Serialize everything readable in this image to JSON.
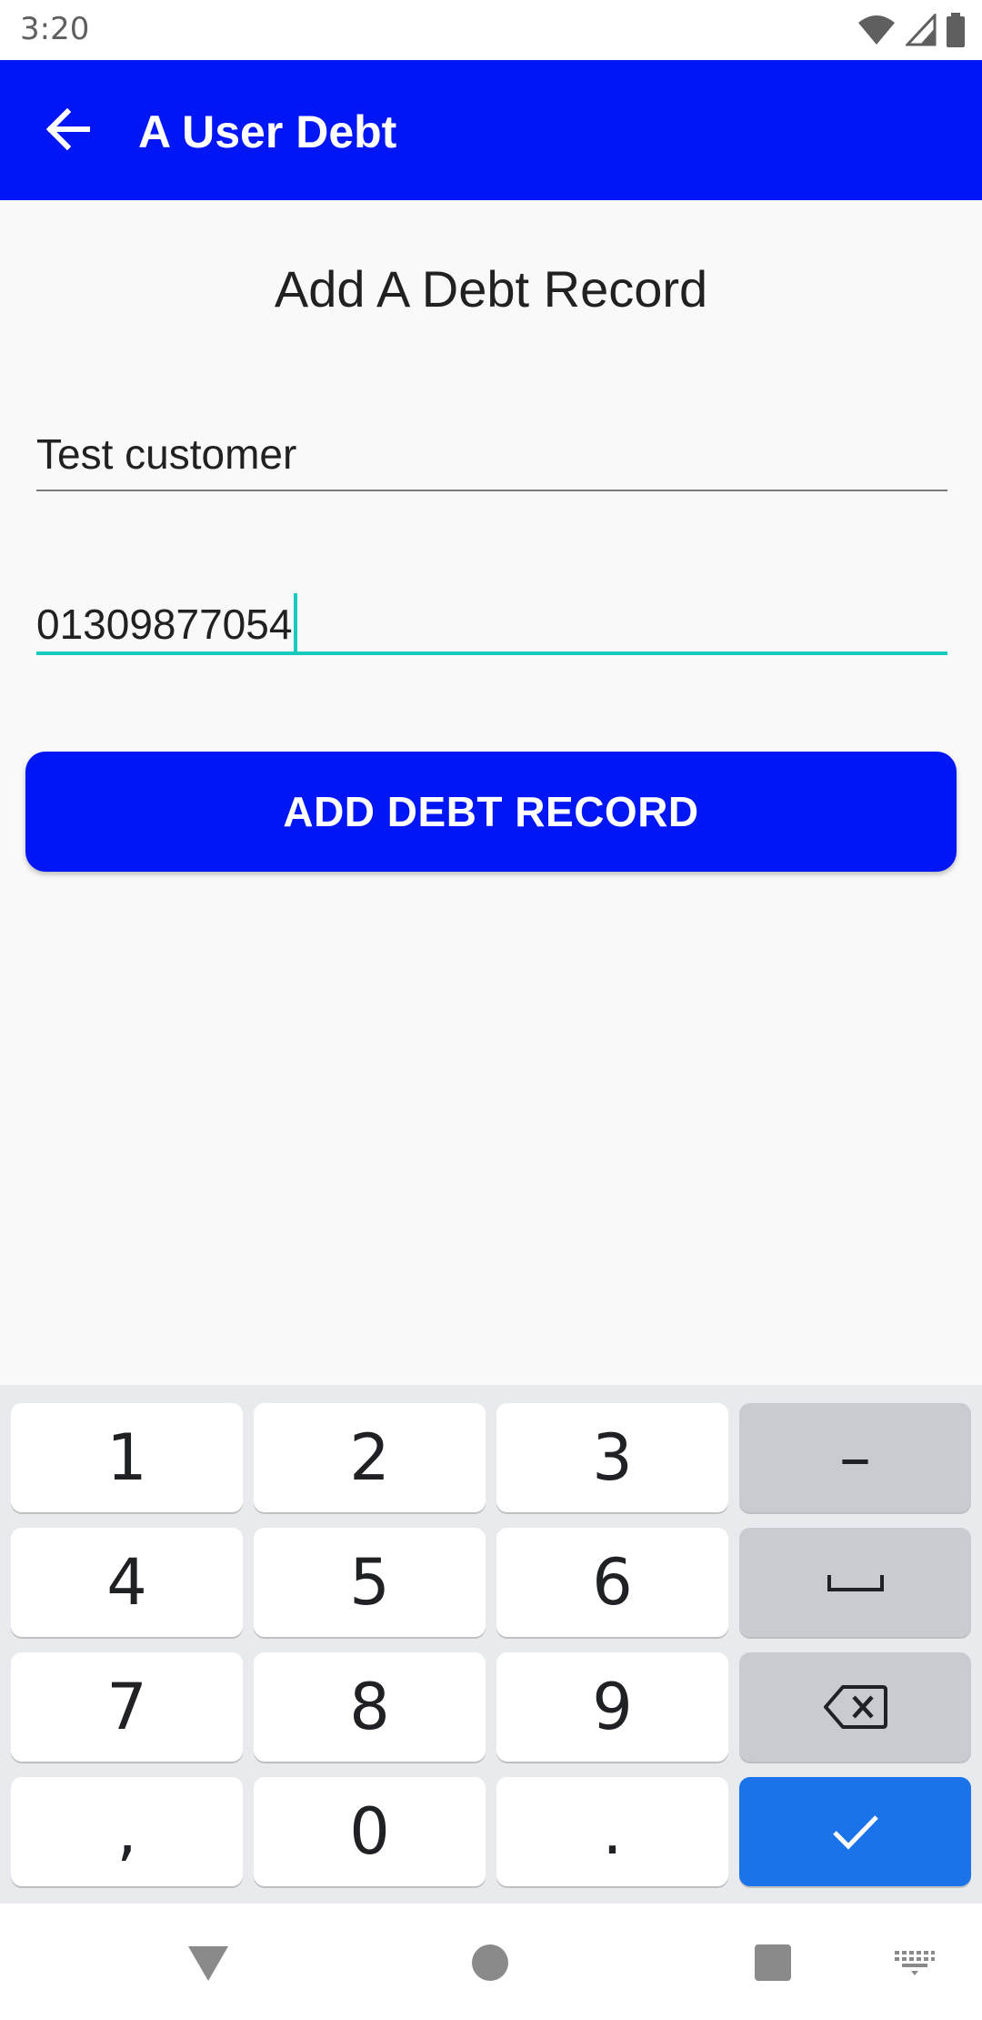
{
  "status_bar": {
    "time": "3:20",
    "icons": [
      "wifi-icon",
      "signal-icon",
      "battery-icon"
    ]
  },
  "app_bar": {
    "title": "A User Debt",
    "back_icon": "arrow-back-icon",
    "color": "#0016f5"
  },
  "form": {
    "heading": "Add A Debt Record",
    "customer_name": {
      "value": "Test customer"
    },
    "phone_number": {
      "value": "01309877054",
      "focused": true
    },
    "submit_label": "ADD DEBT RECORD"
  },
  "keyboard": {
    "rows": [
      [
        "1",
        "2",
        "3",
        "–"
      ],
      [
        "4",
        "5",
        "6",
        "space-icon"
      ],
      [
        "7",
        "8",
        "9",
        "backspace-icon"
      ],
      [
        ",",
        "0",
        ".",
        "check-icon"
      ]
    ],
    "accent": "#1a73e8"
  },
  "nav_bar": {
    "icons": [
      "back-triangle-icon",
      "home-circle-icon",
      "recents-square-icon",
      "keyboard-switch-icon"
    ]
  }
}
